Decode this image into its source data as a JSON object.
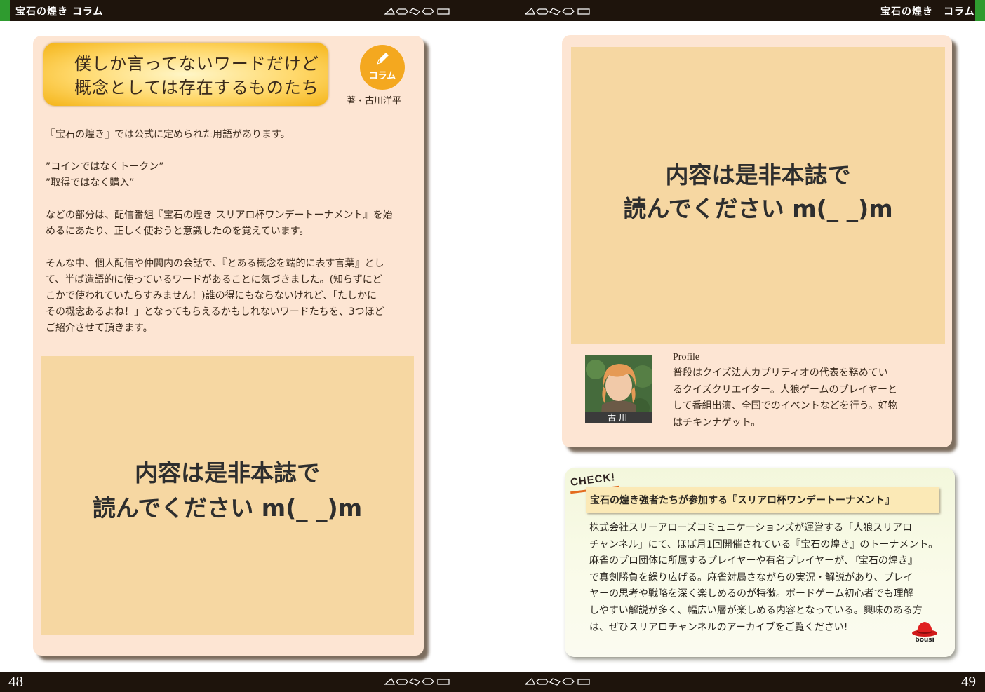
{
  "header": {
    "left_title": "宝石の煌き コラム",
    "right_title": "宝石の煌き　コラム"
  },
  "footer": {
    "left_page": "48",
    "right_page": "49"
  },
  "left_page": {
    "title_lines": [
      "僕しか言ってないワードだけど",
      "概念としては存在するものたち"
    ],
    "badge_label": "コラム",
    "author": "著・古川洋平",
    "body_lines": [
      "『宝石の煌き』では公式に定められた用語があります。",
      "",
      "”コインではなくトークン”",
      "”取得ではなく購入”",
      "",
      "などの部分は、配信番組『宝石の煌き スリアロ杯ワンデートーナメント』を始",
      "めるにあたり、正しく使おうと意識したのを覚えています。",
      "",
      "そんな中、個人配信や仲間内の会話で、『とある概念を端的に表す言葉』とし",
      "て、半ば造語的に使っているワードがあることに気づきました。(知らずにど",
      "こかで使われていたらすみません！)誰の得にもならないけれど、「たしかに",
      "その概念あるよね！」となってもらえるかもしれないワードたちを、3つほど",
      "ご紹介させて頂きます。"
    ],
    "placeholder_lines": [
      "内容は是非本誌で",
      "読んでください m(_ _)m"
    ]
  },
  "right_page": {
    "placeholder_lines": [
      "内容は是非本誌で",
      "読んでください m(_ _)m"
    ],
    "profile": {
      "name": "古川",
      "label": "Profile",
      "lines": [
        "普段はクイズ法人カプリティオの代表を務めてい",
        "るクイズクリエイター。人狼ゲームのプレイヤーと",
        "して番組出演、全国でのイベントなどを行う。好物",
        "はチキンナゲット。"
      ]
    },
    "check": {
      "label": "CHECK!",
      "title": "宝石の煌き強者たちが参加する『スリアロ杯ワンデートーナメント』",
      "lines": [
        "株式会社スリーアローズコミュニケーションズが運営する「人狼スリアロ",
        "チャンネル」にて、ほぼ月1回開催されている『宝石の煌き』のトーナメント。",
        "麻雀のプロ団体に所属するプレイヤーや有名プレイヤーが、『宝石の煌き』",
        "で真剣勝負を繰り広げる。麻雀対局さながらの実況・解説があり、プレイ",
        "ヤーの思考や戦略を深く楽しめるのが特徴。ボードゲーム初心者でも理解",
        "しやすい解説が多く、幅広い層が楽しめる内容となっている。興味のある方",
        "は、ぜひスリアロチャンネルのアーカイブをご覧ください!"
      ],
      "logo_text": "bousi"
    }
  },
  "colors": {
    "bar": "#1e140c",
    "green_tab": "#2f9b2f",
    "card": "#fde5d3",
    "placeholder": "#f6d7a2",
    "badge": "#f4a81f",
    "check_accent": "#e46b1e"
  },
  "icons": {
    "gems": "gem-icons",
    "badge": "pencil-icon",
    "logo": "red-hat-icon"
  }
}
